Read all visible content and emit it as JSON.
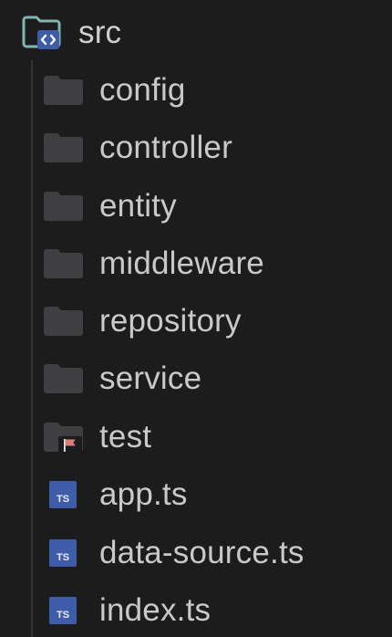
{
  "explorer": {
    "root": {
      "label": "src",
      "icon": "folder-src-icon"
    },
    "folders": [
      {
        "label": "config",
        "icon": "folder-icon"
      },
      {
        "label": "controller",
        "icon": "folder-icon"
      },
      {
        "label": "entity",
        "icon": "folder-icon"
      },
      {
        "label": "middleware",
        "icon": "folder-icon"
      },
      {
        "label": "repository",
        "icon": "folder-icon"
      },
      {
        "label": "service",
        "icon": "folder-icon"
      },
      {
        "label": "test",
        "icon": "folder-test-icon"
      }
    ],
    "files": [
      {
        "label": "app.ts",
        "icon": "typescript-file-icon",
        "badge": "TS"
      },
      {
        "label": "data-source.ts",
        "icon": "typescript-file-icon",
        "badge": "TS"
      },
      {
        "label": "index.ts",
        "icon": "typescript-file-icon",
        "badge": "TS"
      }
    ]
  },
  "colors": {
    "background": "#1c1c1d",
    "text": "#c9c9c9",
    "folder": "#3f3f41",
    "src_folder": "#7fb7b0",
    "ts_badge": "#3f5ca8",
    "test_flag": "#e07a7a"
  }
}
